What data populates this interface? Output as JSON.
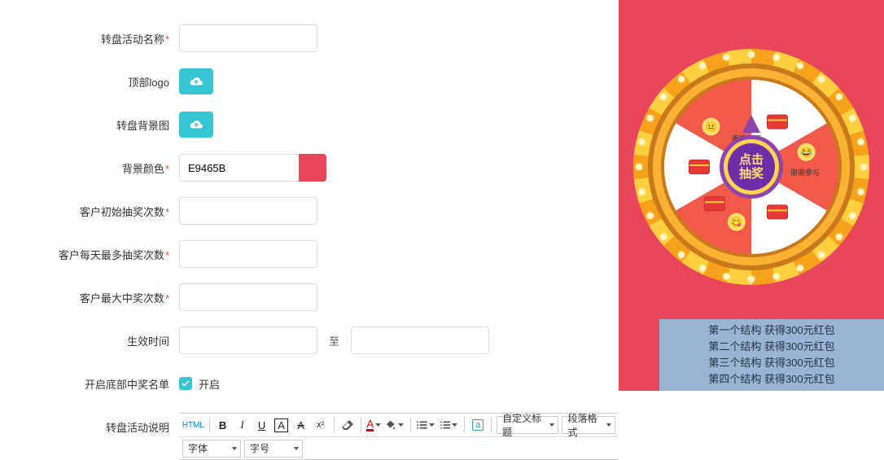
{
  "form": {
    "name_label": "转盘活动名称",
    "name_value": "",
    "logo_label": "顶部logo",
    "bg_label": "转盘背景图",
    "color_label": "背景颜色",
    "color_value": "E9465B",
    "init_label": "客户初始抽奖次数",
    "init_value": "",
    "daily_label": "客户每天最多抽奖次数",
    "daily_value": "",
    "max_label": "客户最大中奖次数",
    "max_value": "",
    "time_label": "生效时间",
    "time_from": "",
    "time_to_word": "至",
    "time_to": "",
    "winners_toggle_label": "开启底部中奖名单",
    "winners_toggle_text": "开启",
    "desc_label": "转盘活动说明"
  },
  "editor": {
    "html": "HTML",
    "b": "B",
    "i": "I",
    "u": "U",
    "a_style": "A",
    "a_strike": "A",
    "sup": "x²",
    "a_color": "A",
    "custom_title": "自定义标题",
    "para_format": "段落格式",
    "font_family": "字体",
    "font_size": "字号"
  },
  "preview": {
    "hub_line1": "点击",
    "hub_line2": "抽奖",
    "winners": [
      "第一个结构 获得300元红包",
      "第二个结构 获得300元红包",
      "第三个结构 获得300元红包",
      "第四个结构 获得300元红包"
    ],
    "sector_hint1": "谢谢参与",
    "sector_hint2": "再接再厉"
  }
}
